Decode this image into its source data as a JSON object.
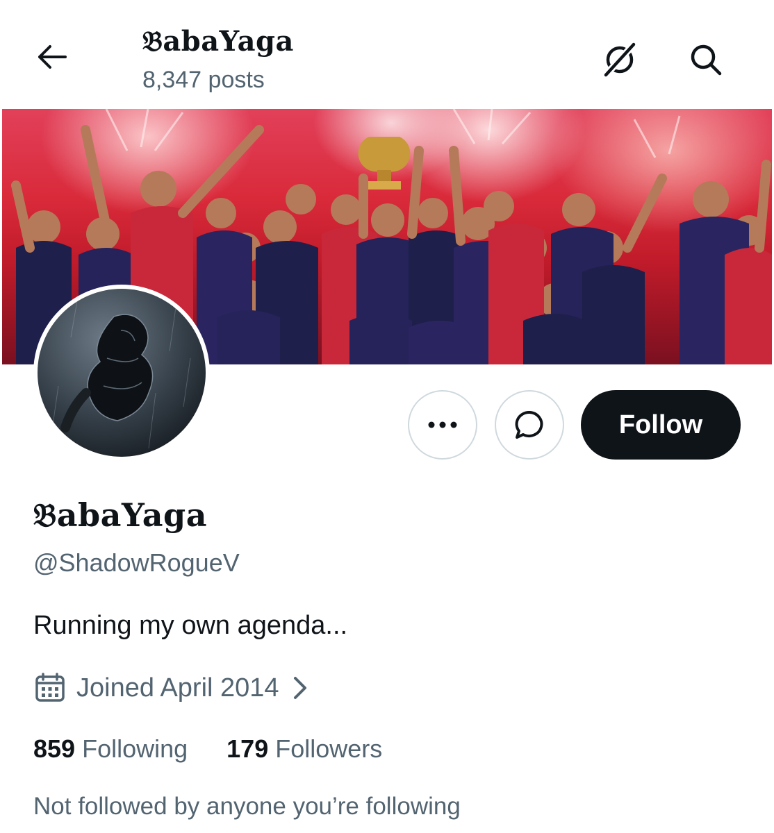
{
  "header": {
    "title": "𝔅abaYaga",
    "posts_count": "8,347 posts",
    "back_icon": "arrow-left-icon",
    "grok_icon": "grok-icon",
    "search_icon": "search-icon"
  },
  "profile": {
    "display_name": "𝔅abaYaga",
    "handle": "@ShadowRogueV",
    "bio": "Running my own agenda...",
    "joined": "Joined April 2014",
    "following_count": "859",
    "following_label": "Following",
    "followers_count": "179",
    "followers_label": "Followers",
    "mutuals_note": "Not followed by anyone you’re following"
  },
  "actions": {
    "more_icon": "more-horizontal-icon",
    "message_icon": "message-bubble-icon",
    "follow_label": "Follow"
  },
  "colors": {
    "primary_text": "#0f1419",
    "secondary_text": "#536471",
    "border": "#cfd9de",
    "follow_bg": "#0f1419"
  }
}
